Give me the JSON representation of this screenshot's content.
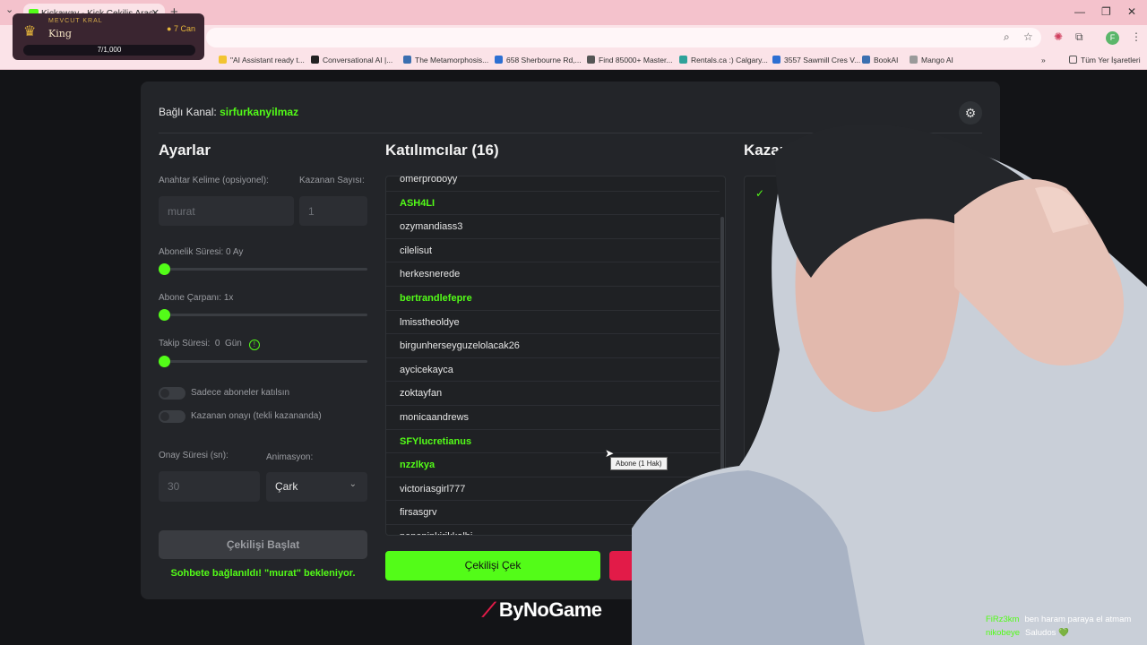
{
  "browser": {
    "tab_title": "Kickaway - Kick Çekiliş Aracı",
    "bookmarks": [
      {
        "label": "\"AI Assistant ready t...",
        "color": "#f2c431"
      },
      {
        "label": "Conversational AI |...",
        "color": "#222222"
      },
      {
        "label": "The Metamorphosis...",
        "color": "#3b6fb0"
      },
      {
        "label": "658 Sherbourne Rd,...",
        "color": "#2d6fd2"
      },
      {
        "label": "Find 85000+ Master...",
        "color": "#555555"
      },
      {
        "label": "Rentals.ca :) Calgary...",
        "color": "#2fa29a"
      },
      {
        "label": "3557 Sawmill Cres V...",
        "color": "#2d6fd2"
      },
      {
        "label": "BookAI",
        "color": "#3b6fb0"
      },
      {
        "label": "Mango AI",
        "color": "#9a9a9a"
      }
    ],
    "all_bookmarks": "Tüm Yer İşaretleri",
    "profile_initial": "F"
  },
  "king": {
    "label": "MEVCUT KRAL",
    "name": "King",
    "can": "7 Can",
    "progress": "7/1,000"
  },
  "panel": {
    "channel_label": "Bağlı Kanal:",
    "channel_name": "sirfurkanyilmaz",
    "settings_title": "Ayarlar",
    "keyword_label": "Anahtar Kelime (opsiyonel):",
    "keyword_value": "murat",
    "winner_count_label": "Kazanan Sayısı:",
    "winner_count_value": "1",
    "sub_duration_label": "Abonelik Süresi: 0 Ay",
    "sub_multiplier_label": "Abone Çarpanı: 1x",
    "follow_duration_label": "Takip Süresi:",
    "follow_duration_value": "0",
    "follow_duration_unit": "Gün",
    "sub_only_label": "Sadece aboneler katılsın",
    "winner_confirm_label": "Kazanan onayı (tekli kazananda)",
    "confirm_time_label": "Onay Süresi (sn):",
    "confirm_time_value": "30",
    "animation_label": "Animasyon:",
    "animation_value": "Çark",
    "start_button": "Çekilişi Başlat",
    "status_text": "Sohbete bağlanıldı! \"murat\" bekleniyor.",
    "participants_title": "Katılımcılar (16)",
    "participants": [
      {
        "name": "omerproboyy",
        "sub": false
      },
      {
        "name": "ASH4LI",
        "sub": true
      },
      {
        "name": "ozymandiass3",
        "sub": false
      },
      {
        "name": "cilelisut",
        "sub": false
      },
      {
        "name": "herkesnerede",
        "sub": false
      },
      {
        "name": "bertrandlefepre",
        "sub": true
      },
      {
        "name": "lmisstheoldye",
        "sub": false
      },
      {
        "name": "birgunherseyguzelolacak26",
        "sub": false
      },
      {
        "name": "aycicekayca",
        "sub": false
      },
      {
        "name": "zoktayfan",
        "sub": false
      },
      {
        "name": "monicaandrews",
        "sub": false
      },
      {
        "name": "SFYlucretianus",
        "sub": true
      },
      {
        "name": "nzzlkya",
        "sub": true
      },
      {
        "name": "victoriasgirl777",
        "sub": false
      },
      {
        "name": "firsasgrv",
        "sub": false
      },
      {
        "name": "pepepinkirikkalbi",
        "sub": false
      }
    ],
    "tooltip": "Abone (1 Hak)",
    "draw_button": "Çekilişi Çek",
    "winners_title": "Kazanan"
  },
  "brand": "ByNoGame",
  "chat": [
    {
      "user": "FiRz3km",
      "msg": "ben haram paraya el atmam"
    },
    {
      "user": "nikobeye",
      "msg": "Saludos 💚"
    }
  ]
}
